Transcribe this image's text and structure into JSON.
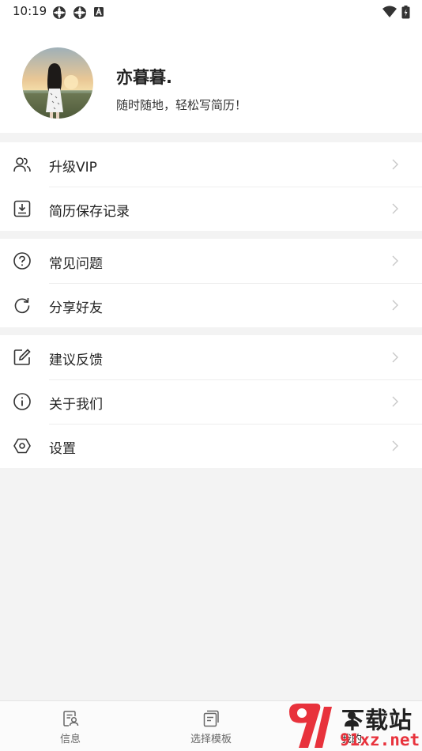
{
  "status_bar": {
    "time": "10:19"
  },
  "profile": {
    "nickname": "亦暮暮.",
    "slogan": "随时随地，轻松写简历！"
  },
  "menu_groups": [
    {
      "items": [
        {
          "label": "升级VIP",
          "icon": "users-icon"
        },
        {
          "label": "简历保存记录",
          "icon": "download-icon"
        }
      ]
    },
    {
      "items": [
        {
          "label": "常见问题",
          "icon": "help-icon"
        },
        {
          "label": "分享好友",
          "icon": "refresh-icon"
        }
      ]
    },
    {
      "items": [
        {
          "label": "建议反馈",
          "icon": "edit-icon"
        },
        {
          "label": "关于我们",
          "icon": "info-icon"
        },
        {
          "label": "设置",
          "icon": "settings-icon"
        }
      ]
    }
  ],
  "tab_bar": {
    "tabs": [
      {
        "label": "信息",
        "icon": "info-card-icon"
      },
      {
        "label": "选择模板",
        "icon": "template-icon"
      },
      {
        "label": "我的",
        "icon": "profile-icon"
      }
    ]
  },
  "watermark": {
    "text": "下载站",
    "url_text": "91xz.net"
  },
  "colors": {
    "background": "#f3f3f3",
    "watermark_red": "#e8323c"
  }
}
